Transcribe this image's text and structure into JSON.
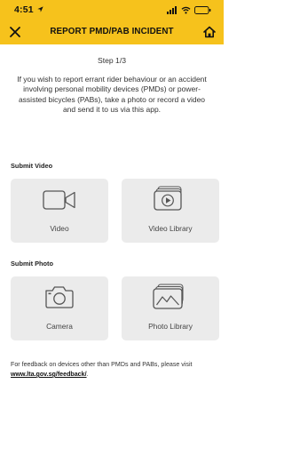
{
  "status_bar": {
    "time": "4:51",
    "icons": [
      "location-arrow-icon",
      "signal-icon",
      "wifi-icon",
      "battery-icon"
    ]
  },
  "header": {
    "title": "REPORT PMD/PAB INCIDENT",
    "left_icon": "close-icon",
    "right_icon": "home-icon",
    "background_color": "#f6c21c"
  },
  "content": {
    "step": "Step 1/3",
    "intro": "If you wish to report errant rider behaviour or an accident involving personal mobility devices (PMDs) or power-assisted bicycles (PABs), take a photo or record a video and send it to us via this app.",
    "submit_video": {
      "label": "Submit Video",
      "tiles": [
        {
          "label": "Video",
          "icon": "video-camera-icon"
        },
        {
          "label": "Video Library",
          "icon": "video-library-icon"
        }
      ]
    },
    "submit_photo": {
      "label": "Submit Photo",
      "tiles": [
        {
          "label": "Camera",
          "icon": "camera-icon"
        },
        {
          "label": "Photo Library",
          "icon": "photo-library-icon"
        }
      ]
    },
    "feedback": {
      "text": "For feedback on devices other than PMDs and PABs, please visit ",
      "link_text": "www.lta.gov.sg/feedback/",
      "trailing": "."
    }
  }
}
